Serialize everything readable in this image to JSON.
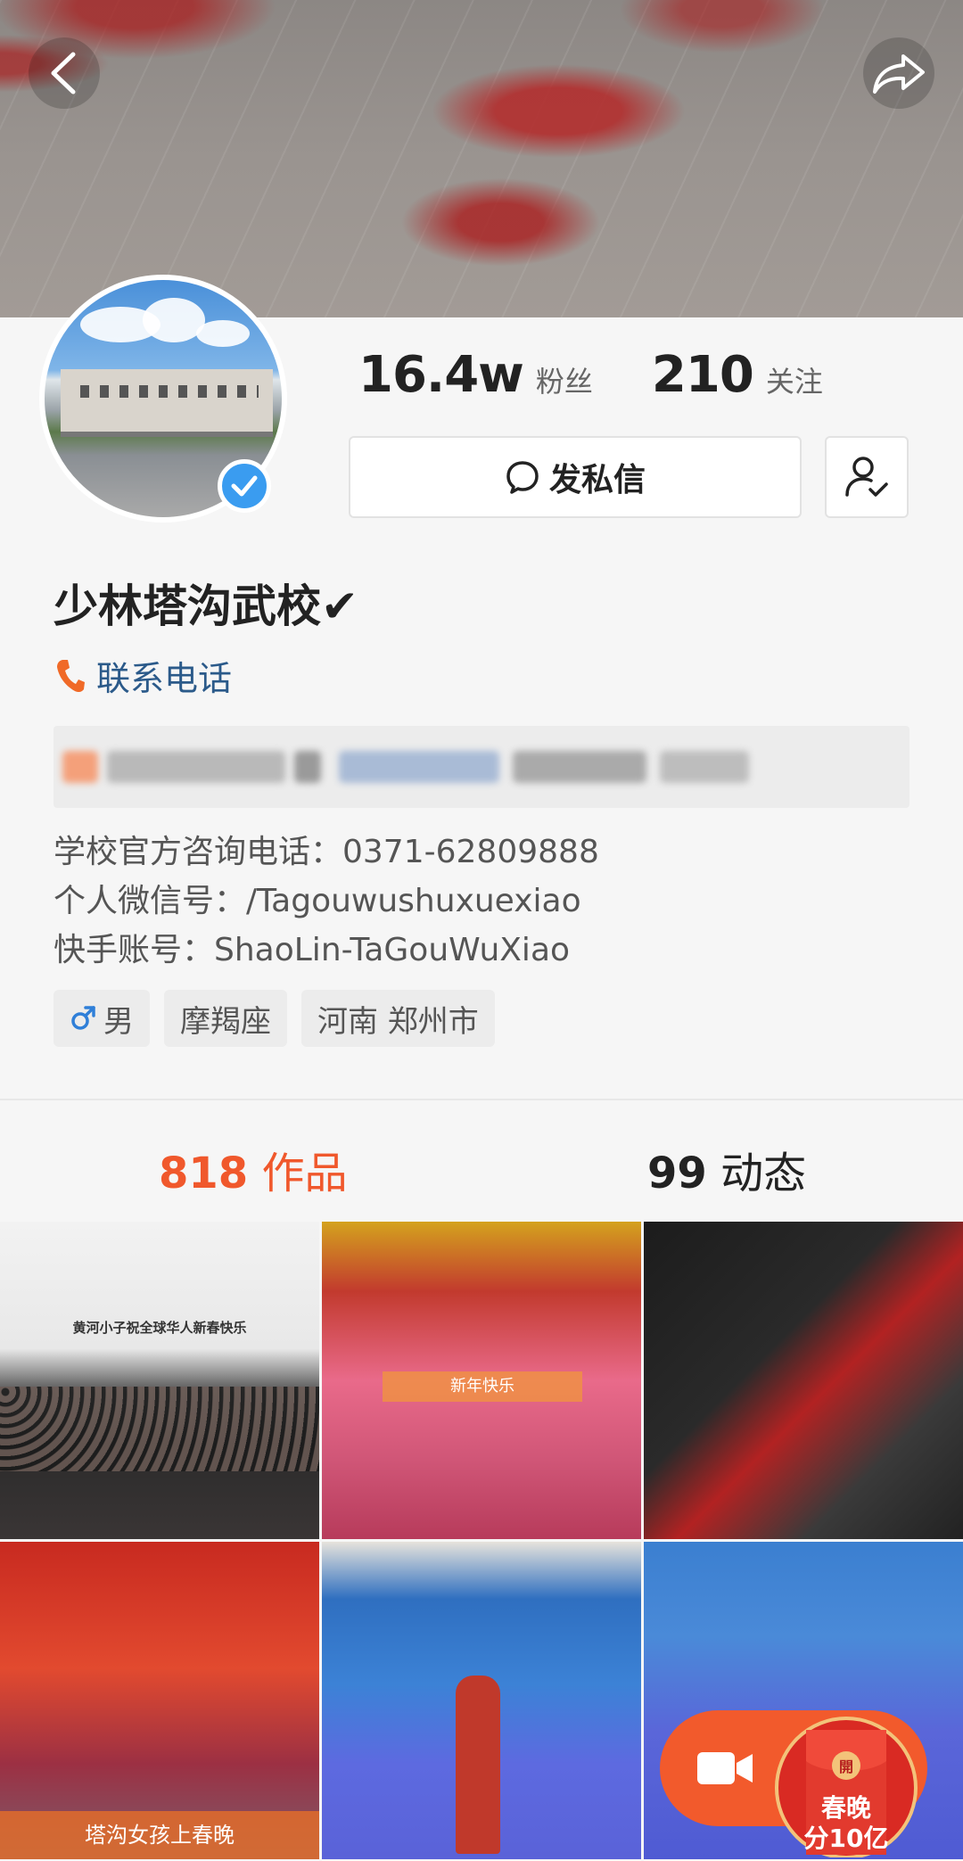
{
  "header": {
    "back_icon": "chevron-left-icon",
    "share_icon": "share-arrow-icon"
  },
  "profile": {
    "followers_count": "16.4w",
    "followers_label": "粉丝",
    "following_count": "210",
    "following_label": "关注",
    "message_button": "发私信",
    "username": "少林塔沟武校✔",
    "contact_label": "联系电话",
    "bio_lines": [
      "学校官方咨询电话：0371-62809888",
      "个人微信号：/Tagouwushuxuexiao",
      "快手账号：ShaoLin-TaGouWuXiao"
    ],
    "tags": [
      {
        "icon": "male-icon",
        "label": "男"
      },
      {
        "label": "摩羯座"
      },
      {
        "label": "河南 郑州市"
      }
    ]
  },
  "tabs": {
    "works_count": "818",
    "works_label": "作品",
    "moments_count": "99",
    "moments_label": "动态"
  },
  "grid": {
    "items": [
      {
        "caption": "黄河小子祝全球华人新春快乐"
      },
      {
        "caption": "新年快乐"
      },
      {
        "caption": ""
      },
      {
        "caption": "塔沟女孩上春晚"
      },
      {
        "caption": ""
      },
      {
        "caption": ""
      }
    ]
  },
  "floating": {
    "camera_icon": "video-camera-icon",
    "red_packet_char": "開",
    "red_packet_line1": "春晚",
    "red_packet_line2": "分10亿"
  },
  "colors": {
    "accent": "#f0582c",
    "link": "#2b5a8a",
    "verified": "#3a9cf0"
  }
}
